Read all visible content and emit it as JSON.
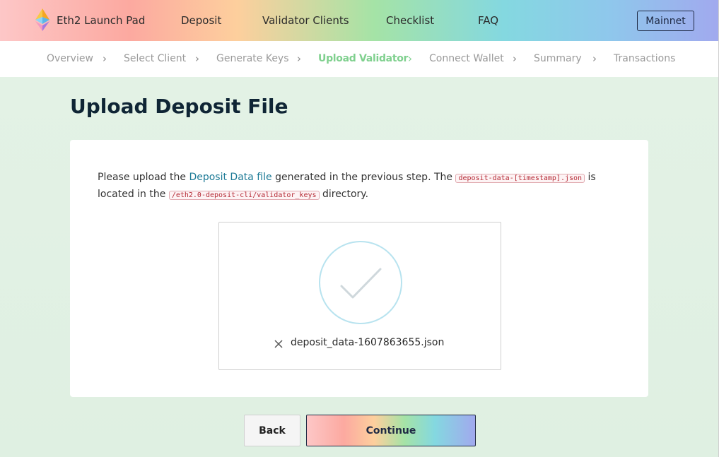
{
  "header": {
    "brand": "Eth2 Launch Pad",
    "nav": [
      "Deposit",
      "Validator Clients",
      "Checklist",
      "FAQ"
    ],
    "network": "Mainnet"
  },
  "steps": {
    "items": [
      "Overview",
      "Select Client",
      "Generate Keys",
      "Upload Validator",
      "Connect Wallet",
      "Summary",
      "Transactions"
    ],
    "active": "Upload Validator"
  },
  "page": {
    "title": "Upload Deposit File"
  },
  "instructions": {
    "part1": "Please upload the ",
    "link": "Deposit Data file",
    "part2": " generated in the previous step. The ",
    "code1": "deposit-data-[timestamp].json",
    "part3": " is located in the ",
    "code2": "/eth2.0-deposit-cli/validator_keys",
    "part4": " directory."
  },
  "upload": {
    "file_name": "deposit_data-1607863655.json",
    "icons": {
      "status": "check-circle-icon",
      "remove": "close-icon"
    }
  },
  "buttons": {
    "back": "Back",
    "continue": "Continue"
  },
  "colors": {
    "active_step": "#7fd08e",
    "link": "#1c7a96",
    "code": "#b52b36",
    "title": "#0f2535",
    "check_ring": "#b8e3ef"
  }
}
